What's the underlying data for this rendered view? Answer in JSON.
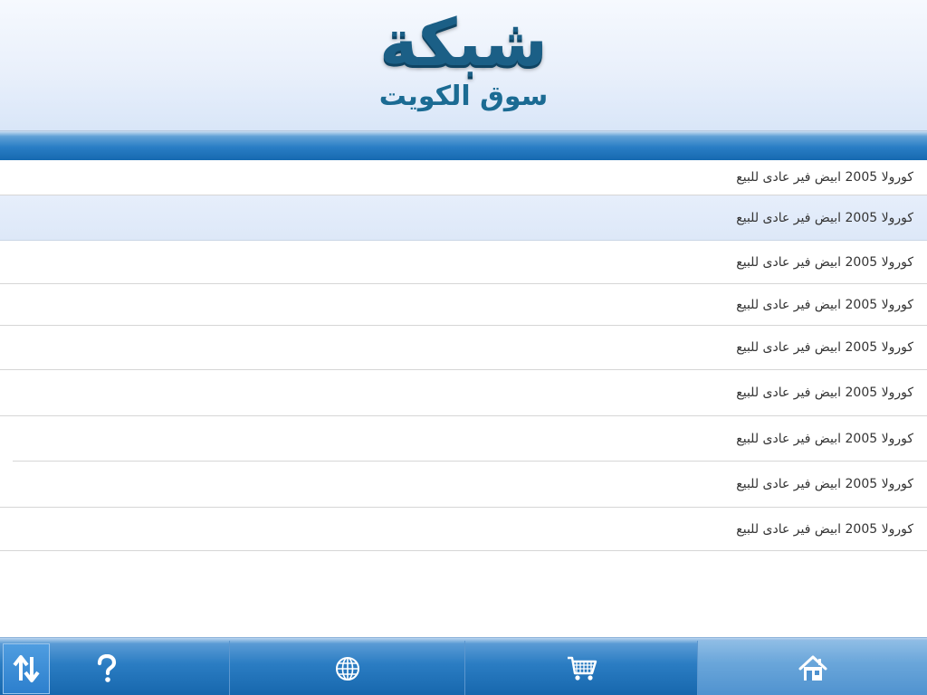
{
  "header": {
    "logo_main": "شبكة",
    "logo_sub": "سوق الكويت"
  },
  "list": {
    "items": [
      {
        "label": "كورولا 2005 ابيض فير عادى للبيع"
      },
      {
        "label": "كورولا 2005 ابيض فير عادى للبيع",
        "selected": true
      },
      {
        "label": "كورولا 2005 ابيض فير عادى للبيع"
      },
      {
        "label": "كورولا 2005 ابيض فير عادى للبيع"
      },
      {
        "label": "كورولا 2005 ابيض فير عادى للبيع"
      },
      {
        "label": "كورولا 2005 ابيض فير عادى للبيع"
      },
      {
        "label": "كورولا 2005 ابيض فير عادى للبيع"
      },
      {
        "label": "كورولا 2005 ابيض فير عادى للبيع"
      },
      {
        "label": "كورولا 2005 ابيض فير عادى للبيع"
      }
    ]
  },
  "tabbar": {
    "sort_icon": "sort-arrows-icon",
    "help_icon": "help-icon",
    "tabs": [
      {
        "name": "globe",
        "icon": "globe-icon"
      },
      {
        "name": "cart",
        "icon": "cart-icon"
      },
      {
        "name": "home",
        "icon": "home-icon",
        "active": true
      }
    ]
  },
  "colors": {
    "brand_blue": "#1b5f86",
    "bar_blue": "#2a7ec5",
    "selected_row": "#e2ebf9",
    "text": "#333333"
  }
}
